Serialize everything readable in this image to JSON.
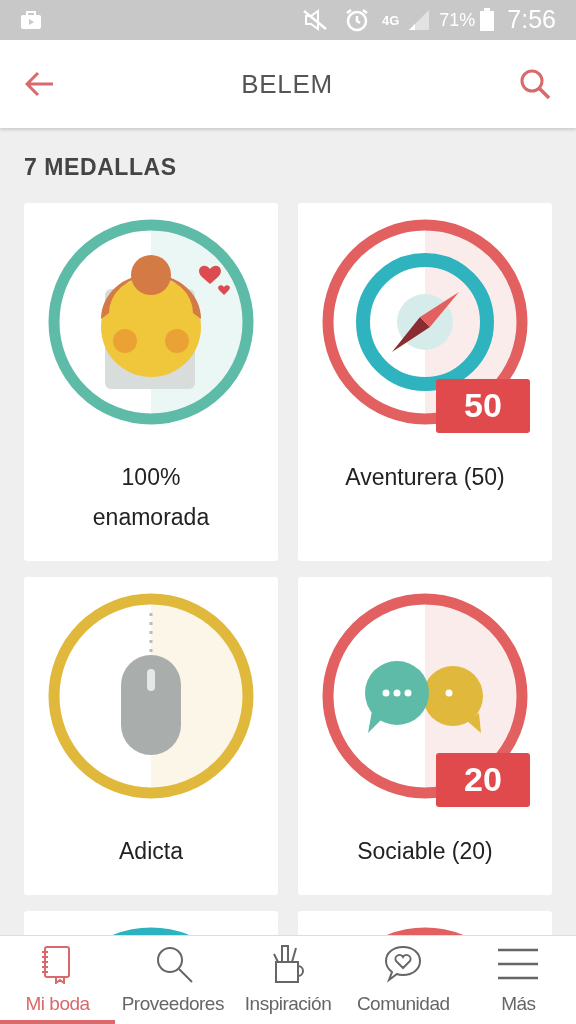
{
  "status_bar": {
    "battery": "71%",
    "time": "7:56",
    "network": "4G"
  },
  "header": {
    "title": "BELEM"
  },
  "section_title": "7 MEDALLAS",
  "medals": [
    {
      "kind": "bride",
      "label": "100%\nenamorada",
      "color": "#5dbba8"
    },
    {
      "kind": "compass",
      "label": "Aventurera (50)",
      "color": "#e2605f",
      "badge": "50"
    },
    {
      "kind": "mouse",
      "label": "Adicta",
      "color": "#e0b93c"
    },
    {
      "kind": "chat",
      "label": "Sociable (20)",
      "color": "#e2605f",
      "badge": "20"
    },
    {
      "kind": "cut",
      "color": "#2cb3bf"
    },
    {
      "kind": "cut",
      "color": "#e2605f"
    }
  ],
  "nav": [
    {
      "kind": "notebook",
      "label": "Mi boda",
      "selected": true
    },
    {
      "kind": "search",
      "label": "Proveedores",
      "selected": false
    },
    {
      "kind": "cup",
      "label": "Inspiración",
      "selected": false
    },
    {
      "kind": "chat",
      "label": "Comunidad",
      "selected": false
    },
    {
      "kind": "menu",
      "label": "Más",
      "selected": false
    }
  ]
}
